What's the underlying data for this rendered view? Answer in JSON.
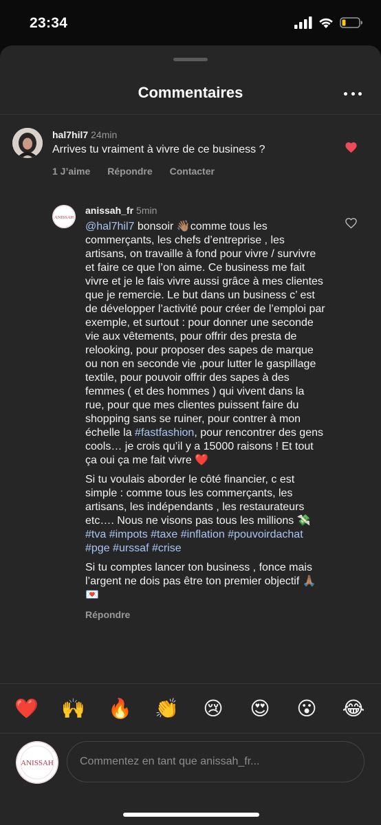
{
  "status_bar": {
    "time": "23:34"
  },
  "header": {
    "title": "Commentaires"
  },
  "comment": {
    "username": "hal7hil7",
    "time": "24min",
    "text": "Arrives tu vraiment à vivre de ce business ?",
    "likes_label": "1 J’aime",
    "reply_label": "Répondre",
    "contact_label": "Contacter",
    "liked": true
  },
  "reply": {
    "username": "anissah_fr",
    "time": "5min",
    "avatar_text": "ANISSAH",
    "p1_mention": "@hal7hil7",
    "p1_a": " bonsoir 👋🏽comme tous les commerçants, les chefs d’entreprise , les artisans, on travaille à fond pour vivre / survivre et faire ce que l’on aime. Ce business me fait vivre et je le fais vivre aussi grâce à mes clientes que je remercie. Le but dans un business c’ est de développer l’activité pour créer de l’emploi par exemple, et surtout : pour donner une seconde vie aux vêtements, pour offrir des presta de relooking, pour proposer des sapes de marque ou non en seconde vie ,pour lutter le gaspillage textile, pour pouvoir offrir des sapes à des femmes ( et des hommes ) qui vivent dans la rue, pour que mes clientes puissent faire du shopping sans se ruiner, pour contrer à mon échelle la ",
    "p1_tag": "#fastfashion",
    "p1_b": ", pour rencontrer des gens cools… je crois qu’il y a 15000 raisons !  Et tout ça oui ça me fait vivre ❤️",
    "p2_a": "Si tu voulais aborder le côté financier, c est simple : comme tous les commerçants, les artisans, les indépendants , les restaurateurs etc…. Nous ne visons pas tous les millions 💸 ",
    "p2_tags": "#tva #impots #taxe #inflation #pouvoirdachat #pge #urssaf #crise",
    "p3": "Si tu comptes lancer ton business , fonce mais l’argent ne dois pas être ton premier objectif 🙏🏽💌",
    "reply_label": "Répondre"
  },
  "reactions": [
    "❤️",
    "🙌",
    "🔥",
    "👏",
    "😢",
    "😍",
    "😮",
    "😂"
  ],
  "composer": {
    "placeholder": "Commentez en tant que anissah_fr...",
    "avatar_text": "ANISSAH"
  },
  "colors": {
    "accent_link": "#a9c6f2",
    "like_red": "#ed4956",
    "sheet_bg": "#262626"
  }
}
